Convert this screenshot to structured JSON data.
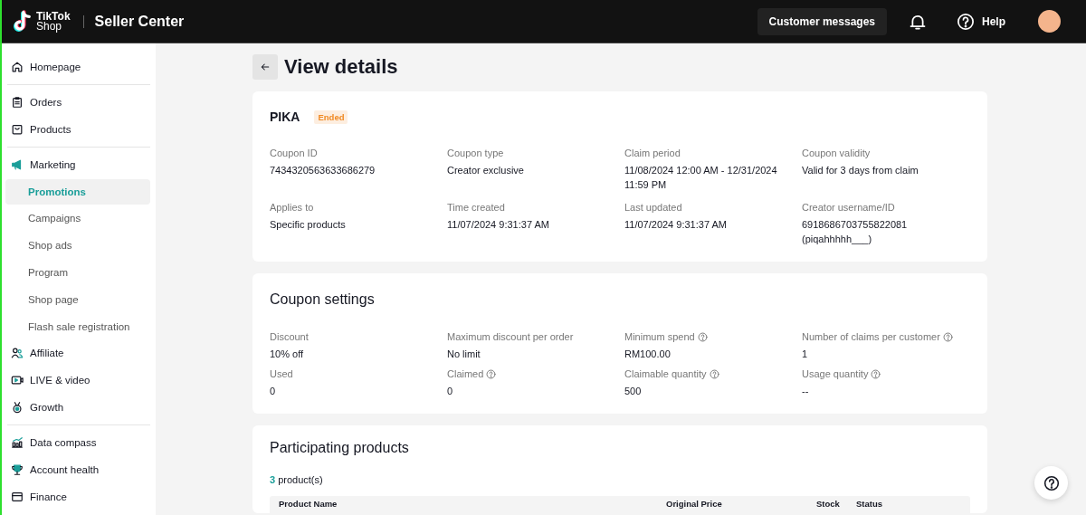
{
  "header": {
    "logo": {
      "line_1": "TikTok",
      "line_2": "Shop"
    },
    "product": "Seller Center",
    "messages_button": "Customer messages",
    "help": "Help"
  },
  "sidebar": {
    "groups": [
      {
        "items": [
          {
            "label": "Homepage",
            "selected": false
          }
        ]
      },
      {
        "items": [
          {
            "label": "Orders",
            "selected": false
          },
          {
            "label": "Products",
            "selected": false
          }
        ]
      },
      {
        "items": [
          {
            "label": "Marketing",
            "selected": false,
            "children": [
              {
                "label": "Promotions",
                "selected": true
              },
              {
                "label": "Campaigns",
                "selected": false
              },
              {
                "label": "Shop ads",
                "selected": false
              },
              {
                "label": "Program",
                "selected": false
              },
              {
                "label": "Shop page",
                "selected": false
              },
              {
                "label": "Flash sale registration",
                "selected": false
              }
            ]
          },
          {
            "label": "Affiliate",
            "selected": false
          },
          {
            "label": "LIVE & video",
            "selected": false
          },
          {
            "label": "Growth",
            "selected": false
          }
        ]
      },
      {
        "items": [
          {
            "label": "Data compass",
            "selected": false
          },
          {
            "label": "Account health",
            "selected": false
          },
          {
            "label": "Finance",
            "selected": false
          }
        ]
      }
    ]
  },
  "page": {
    "title": "View details"
  },
  "coupon": {
    "name": "PIKA",
    "status": "Ended",
    "fields": [
      {
        "label": "Coupon ID",
        "value": "7434320563633686279"
      },
      {
        "label": "Coupon type",
        "value": "Creator exclusive"
      },
      {
        "label": "Claim period",
        "value": "11/08/2024 12:00 AM - 12/31/2024 11:59 PM"
      },
      {
        "label": "Coupon validity",
        "value": "Valid for 3 days from claim"
      },
      {
        "label": "Applies to",
        "value": "Specific products"
      },
      {
        "label": "Time created",
        "value": "11/07/2024 9:31:37 AM"
      },
      {
        "label": "Last updated",
        "value": "11/07/2024 9:31:37 AM"
      },
      {
        "label": "Creator username/ID",
        "value": "6918686703755822081 (piqahhhhh___)"
      }
    ]
  },
  "settings": {
    "title": "Coupon settings",
    "fields": [
      {
        "label": "Discount",
        "value": "10% off",
        "info": false
      },
      {
        "label": "Maximum discount per order",
        "value": "No limit",
        "info": false
      },
      {
        "label": "Minimum spend",
        "value": "RM100.00",
        "info": true
      },
      {
        "label": "Number of claims per customer",
        "value": "1",
        "info": true
      },
      {
        "label": "Used",
        "value": "0",
        "info": false
      },
      {
        "label": "Claimed",
        "value": "0",
        "info": true
      },
      {
        "label": "Claimable quantity",
        "value": "500",
        "info": true
      },
      {
        "label": "Usage quantity",
        "value": "--",
        "info": true
      }
    ]
  },
  "products": {
    "title": "Participating products",
    "count": "3",
    "count_label": "product(s)",
    "table": {
      "columns": [
        "Product Name",
        "Original Price",
        "Stock",
        "Status"
      ]
    }
  }
}
